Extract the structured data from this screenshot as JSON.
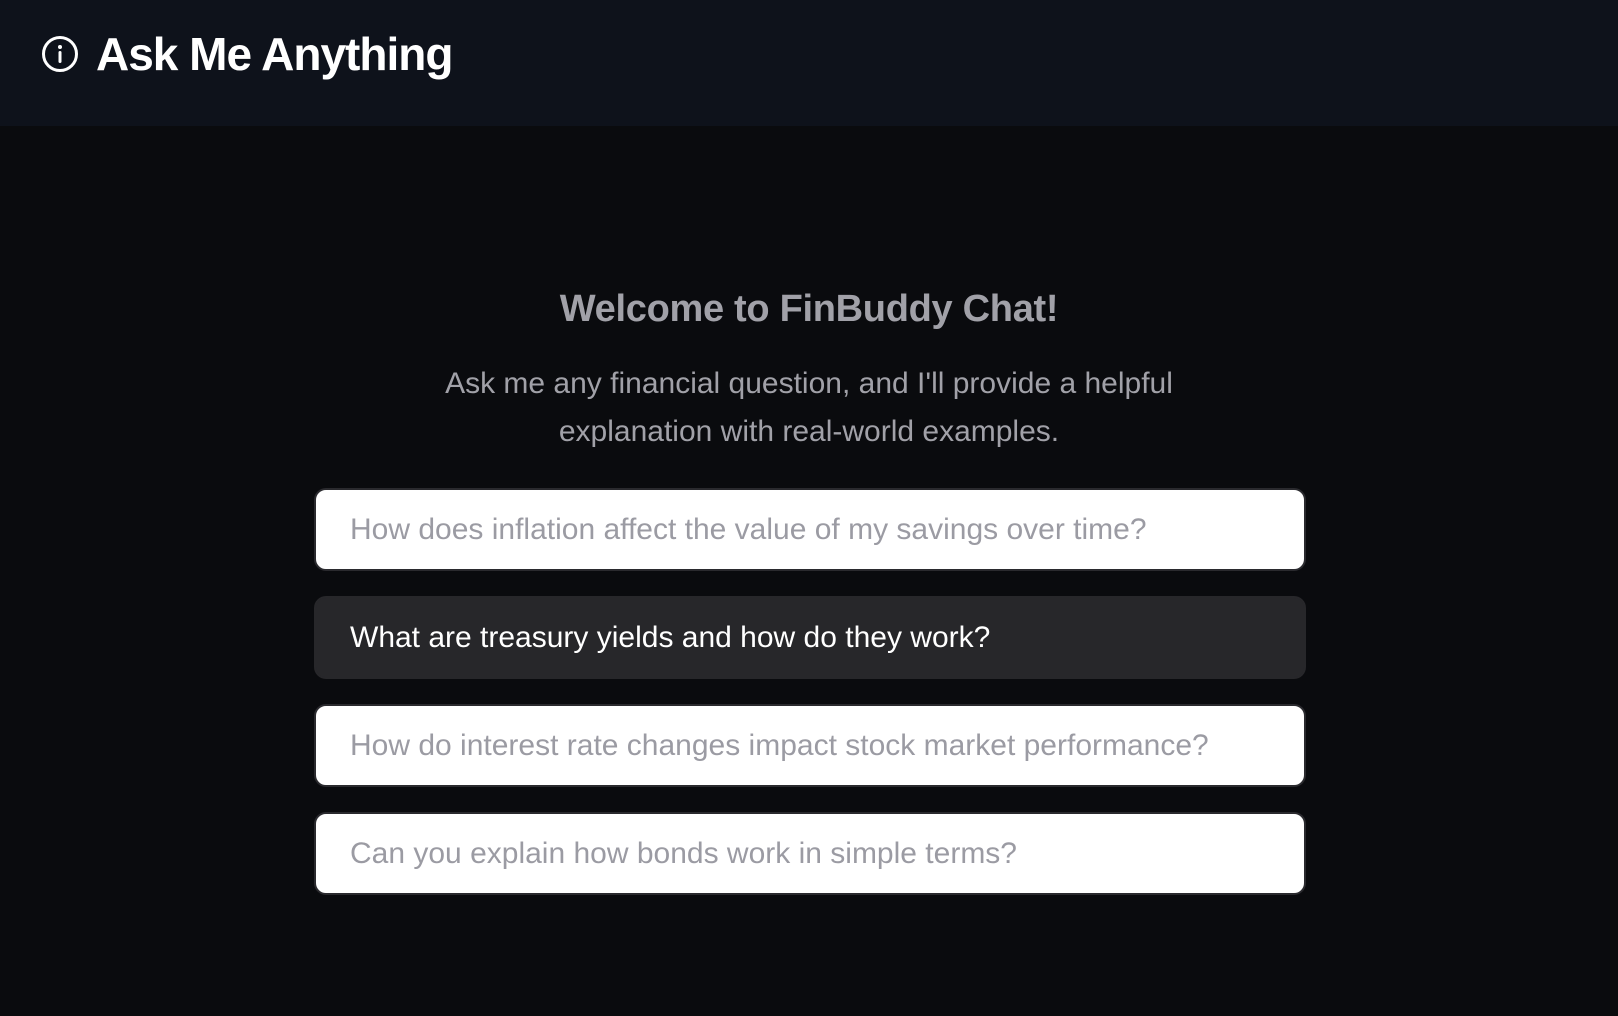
{
  "header": {
    "title": "Ask Me Anything",
    "icon": "info-icon"
  },
  "welcome": {
    "title": "Welcome to FinBuddy Chat!",
    "subtitle": "Ask me any financial question, and I'll provide a helpful explanation with real-world examples."
  },
  "suggestions": [
    {
      "text": "How does inflation affect the value of my savings over time?",
      "state": "default"
    },
    {
      "text": "What are treasury yields and how do they work?",
      "state": "hovered"
    },
    {
      "text": "How do interest rate changes impact stock market performance?",
      "state": "default"
    },
    {
      "text": "Can you explain how bonds work in simple terms?",
      "state": "default"
    }
  ],
  "colors": {
    "header_bg": "#0e121b",
    "page_bg": "#0a0b0e",
    "muted_text": "#a1a1a8",
    "card_light_bg": "#ffffff",
    "card_dark_bg": "#27272a"
  }
}
